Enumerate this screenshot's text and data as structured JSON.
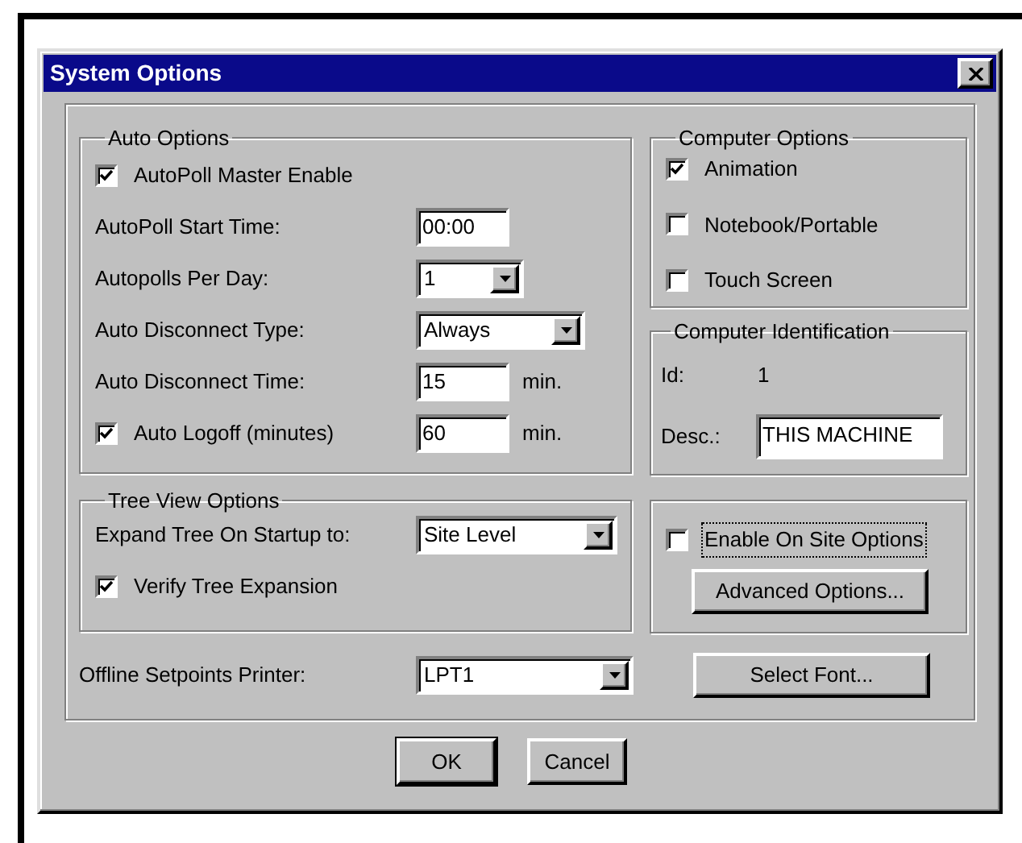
{
  "window": {
    "title": "System Options"
  },
  "auto_options": {
    "title": "Auto Options",
    "rows": [
      {
        "kind": "checkbox",
        "label": "AutoPoll Master Enable",
        "checked": true
      },
      {
        "kind": "textbox",
        "label": "AutoPoll Start Time:",
        "value": "00:00"
      },
      {
        "kind": "dropdown",
        "label": "Autopolls Per Day:",
        "value": "1"
      },
      {
        "kind": "dropdown",
        "label": "Auto Disconnect Type:",
        "value": "Always"
      },
      {
        "kind": "textbox",
        "label": "Auto Disconnect Time:",
        "value": "15",
        "unit": "min."
      },
      {
        "kind": "checkbox_textbox",
        "label": "Auto Logoff (minutes)",
        "checked": true,
        "value": "60",
        "unit": "min."
      }
    ]
  },
  "computer_options": {
    "title": "Computer Options",
    "items": [
      {
        "label": "Animation",
        "checked": true
      },
      {
        "label": "Notebook/Portable",
        "checked": false
      },
      {
        "label": "Touch Screen",
        "checked": false
      }
    ]
  },
  "computer_identification": {
    "title": "Computer Identification",
    "id_label": "Id:",
    "id_value": "1",
    "desc_label": "Desc.:",
    "desc_value": "THIS MACHINE"
  },
  "tree_view_options": {
    "title": "Tree View Options",
    "expand_label": "Expand Tree On Startup to:",
    "expand_value": "Site Level",
    "verify": {
      "label": "Verify Tree Expansion",
      "checked": true
    }
  },
  "site_options": {
    "enable": {
      "label": "Enable On Site Options",
      "checked": false,
      "focused": true
    },
    "button": "Advanced Options..."
  },
  "printer": {
    "label": "Offline Setpoints Printer:",
    "value": "LPT1"
  },
  "select_font_button": "Select Font...",
  "buttons": [
    {
      "label": "OK",
      "default": true
    },
    {
      "label": "Cancel",
      "default": false
    }
  ]
}
